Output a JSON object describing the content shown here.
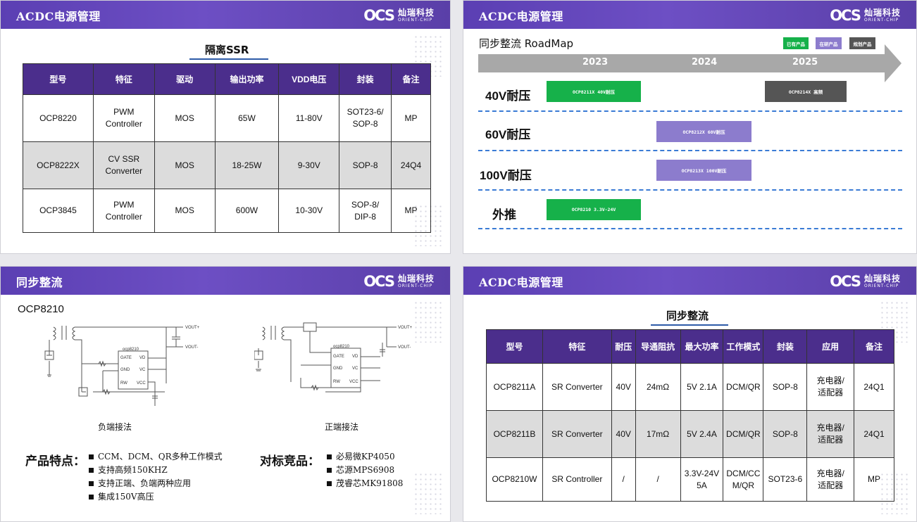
{
  "slide1": {
    "title": "ACDC电源管理",
    "section_title": "隔离SSR",
    "table": {
      "headers": [
        "型号",
        "特征",
        "驱动",
        "输出功率",
        "VDD电压",
        "封装",
        "备注"
      ],
      "rows": [
        [
          "OCP8220",
          "PWM\nController",
          "MOS",
          "65W",
          "11-80V",
          "SOT23-6/\nSOP-8",
          "MP"
        ],
        [
          "OCP8222X",
          "CV SSR\nConverter",
          "MOS",
          "18-25W",
          "9-30V",
          "SOP-8",
          "24Q4"
        ],
        [
          "OCP3845",
          "PWM\nController",
          "MOS",
          "600W",
          "10-30V",
          "SOP-8/\nDIP-8",
          "MP"
        ]
      ]
    }
  },
  "logo": {
    "mark": "OCS",
    "cn": "灿瑞科技",
    "en": "ORIENT-CHIP"
  },
  "slide2": {
    "title": "ACDC电源管理",
    "roadmap_title": "同步整流 RoadMap",
    "legend": [
      {
        "label": "已有产品",
        "color": "#16b14a"
      },
      {
        "label": "在研产品",
        "color": "#8c7ccd"
      },
      {
        "label": "规划产品",
        "color": "#555555"
      }
    ],
    "years": [
      "2023",
      "2024",
      "2025"
    ],
    "rows": [
      {
        "label": "40V耐压",
        "bars": [
          {
            "text": "OCP8211X 40V耐压",
            "status": "已有产品"
          },
          {
            "text": "OCP8214X 高频",
            "status": "规划产品"
          }
        ]
      },
      {
        "label": "60V耐压",
        "bars": [
          {
            "text": "OCP8212X 60V耐压",
            "status": "在研产品"
          }
        ]
      },
      {
        "label": "100V耐压",
        "bars": [
          {
            "text": "OCP8213X 100V耐压",
            "status": "在研产品"
          }
        ]
      },
      {
        "label": "外推",
        "bars": [
          {
            "text": "OCP8210 3.3V-24V",
            "status": "已有产品"
          }
        ]
      }
    ]
  },
  "slide3": {
    "title": "同步整流",
    "part": "OCP8210",
    "schematics": [
      {
        "caption": "负端接法",
        "chip": "ocp8210",
        "pins_left": [
          "GATE",
          "GND",
          "RW"
        ],
        "pins_right": [
          "VD",
          "VC",
          "VCC"
        ],
        "out_pos": "VOUT+",
        "out_neg": "VOUT-"
      },
      {
        "caption": "正端接法",
        "chip": "ocp8210",
        "pins_left": [
          "GATE",
          "GND",
          "RW"
        ],
        "pins_right": [
          "VD",
          "VC",
          "VCC"
        ],
        "out_pos": "VOUT+",
        "out_neg": "VOUT-"
      }
    ],
    "features_label": "产品特点：",
    "features": [
      "CCM、DCM、QR多种工作模式",
      "支持高频150KHZ",
      "支持正端、负端两种应用",
      "集成150V高压"
    ],
    "competitors_label": "对标竞品：",
    "competitors": [
      "必易微KP4050",
      "芯源MPS6908",
      "茂睿芯MK91808"
    ]
  },
  "slide4": {
    "title": "ACDC电源管理",
    "section_title": "同步整流",
    "table": {
      "headers": [
        "型号",
        "特征",
        "耐压",
        "导通阻抗",
        "最大功率",
        "工作模式",
        "封装",
        "应用",
        "备注"
      ],
      "rows": [
        [
          "OCP8211A",
          "SR Converter",
          "40V",
          "24mΩ",
          "5V 2.1A",
          "DCM/QR",
          "SOP-8",
          "充电器/\n适配器",
          "24Q1"
        ],
        [
          "OCP8211B",
          "SR Converter",
          "40V",
          "17mΩ",
          "5V 2.4A",
          "DCM/QR",
          "SOP-8",
          "充电器/\n适配器",
          "24Q1"
        ],
        [
          "OCP8210W",
          "SR Controller",
          "/",
          "/",
          "3.3V-24V\n5A",
          "DCM/CC\nM/QR",
          "SOT23-6",
          "充电器/\n适配器",
          "MP"
        ]
      ]
    }
  }
}
